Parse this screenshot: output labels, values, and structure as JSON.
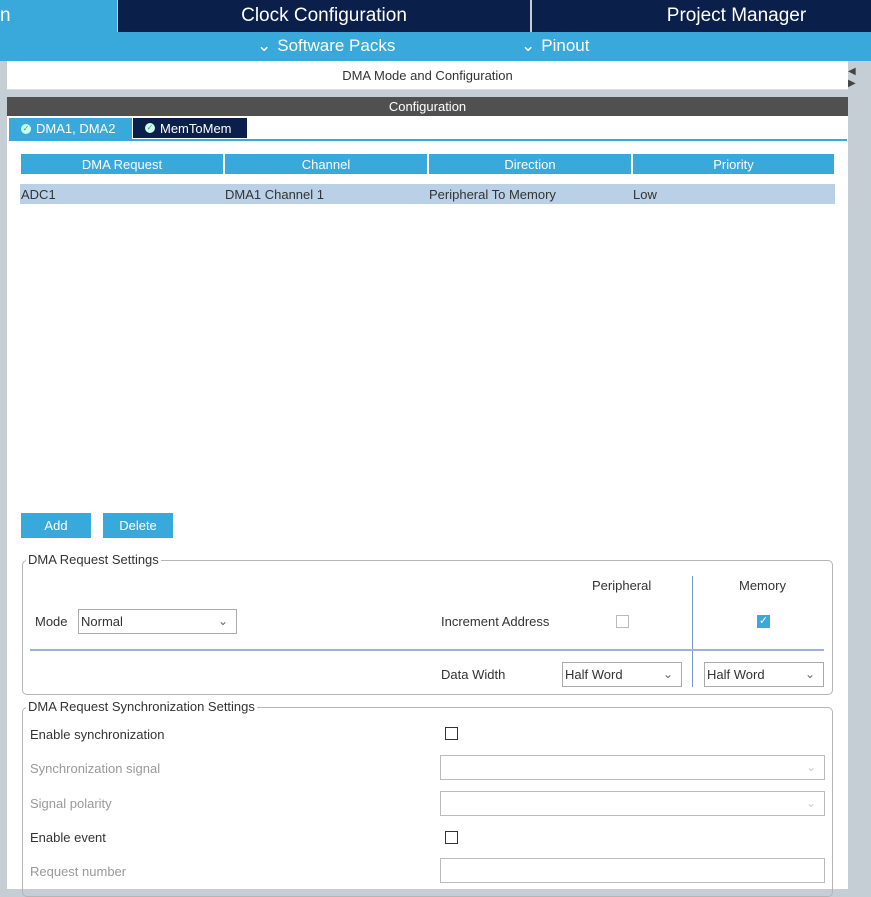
{
  "top_tabs": {
    "partial": "n",
    "clock": "Clock Configuration",
    "project": "Project Manager"
  },
  "sub_menu": {
    "software_packs": "Software Packs",
    "pinout": "Pinout"
  },
  "panel_title": "DMA Mode and Configuration",
  "config_header": "Configuration",
  "tabs": [
    {
      "label": "DMA1, DMA2",
      "active": true
    },
    {
      "label": "MemToMem",
      "active": false
    }
  ],
  "table": {
    "headers": [
      "DMA Request",
      "Channel",
      "Direction",
      "Priority"
    ],
    "rows": [
      [
        "ADC1",
        "DMA1 Channel 1",
        "Peripheral To Memory",
        "Low"
      ]
    ]
  },
  "buttons": {
    "add": "Add",
    "delete": "Delete"
  },
  "request_settings": {
    "legend": "DMA Request Settings",
    "peripheral": "Peripheral",
    "memory": "Memory",
    "mode_label": "Mode",
    "mode_value": "Normal",
    "increment_label": "Increment Address",
    "peripheral_increment": false,
    "memory_increment": true,
    "data_width_label": "Data Width",
    "peripheral_width": "Half Word",
    "memory_width": "Half Word"
  },
  "sync_settings": {
    "legend": "DMA Request Synchronization Settings",
    "enable_sync": "Enable synchronization",
    "sync_signal": "Synchronization signal",
    "signal_polarity": "Signal polarity",
    "enable_event": "Enable event",
    "request_number": "Request number"
  },
  "colors": {
    "accent": "#39a9dc",
    "navy": "#0a1f4a",
    "header_dark": "#505050",
    "row_selected": "#b9d0e6"
  }
}
